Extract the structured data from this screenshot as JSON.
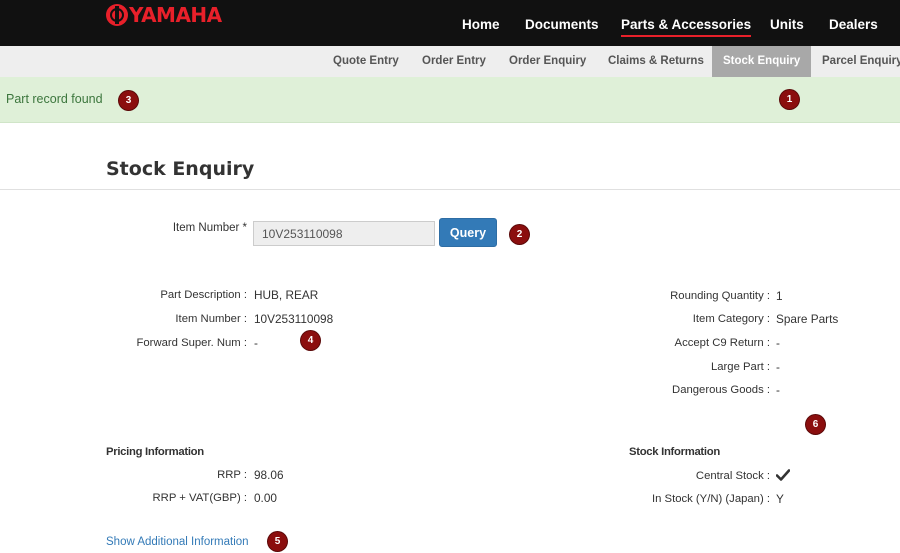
{
  "brand": {
    "logo_text": "YAMAHA",
    "logo_color": "#e8202a"
  },
  "main_nav": {
    "home": "Home",
    "documents": "Documents",
    "parts": "Parts & Accessories",
    "units": "Units",
    "dealers": "Dealers",
    "active": "Parts & Accessories"
  },
  "sub_nav": {
    "quote_entry": "Quote Entry",
    "order_entry": "Order Entry",
    "order_enquiry": "Order Enquiry",
    "claims_returns": "Claims & Returns",
    "stock_enquiry": "Stock Enquiry",
    "parcel_enquiry": "Parcel Enquiry",
    "active": "Stock Enquiry"
  },
  "alert": {
    "message": "Part record found",
    "color": "#dff0d8"
  },
  "page": {
    "title": "Stock Enquiry"
  },
  "form": {
    "item_label": "Item Number *",
    "item_value": "10V253110098",
    "query_label": "Query"
  },
  "details_left": {
    "part_description_label": "Part Description :",
    "part_description_value": "HUB, REAR",
    "item_number_label": "Item Number :",
    "item_number_value": "10V253110098",
    "forward_super_label": "Forward Super. Num :",
    "forward_super_value": "-"
  },
  "details_right": {
    "rounding_qty_label": "Rounding Quantity :",
    "rounding_qty_value": "1",
    "item_category_label": "Item Category :",
    "item_category_value": "Spare Parts",
    "accept_c9_label": "Accept C9 Return :",
    "accept_c9_value": "-",
    "large_part_label": "Large Part :",
    "large_part_value": "-",
    "dangerous_goods_label": "Dangerous Goods :",
    "dangerous_goods_value": "-"
  },
  "pricing": {
    "heading": "Pricing Information",
    "rrp_label": "RRP :",
    "rrp_value": "98.06",
    "rrp_vat_label": "RRP + VAT(GBP) :",
    "rrp_vat_value": "0.00"
  },
  "stock": {
    "heading": "Stock Information",
    "central_label": "Central Stock :",
    "central_icon": "checkmark-icon",
    "instock_label": "In Stock (Y/N) (Japan) :",
    "instock_value": "Y"
  },
  "links": {
    "show_more": "Show Additional Information"
  },
  "badges": [
    "1",
    "2",
    "3",
    "4",
    "5",
    "6"
  ],
  "colors": {
    "accent": "#337ab7",
    "badge": "#8b0e0e",
    "nav_bg": "#111111"
  }
}
